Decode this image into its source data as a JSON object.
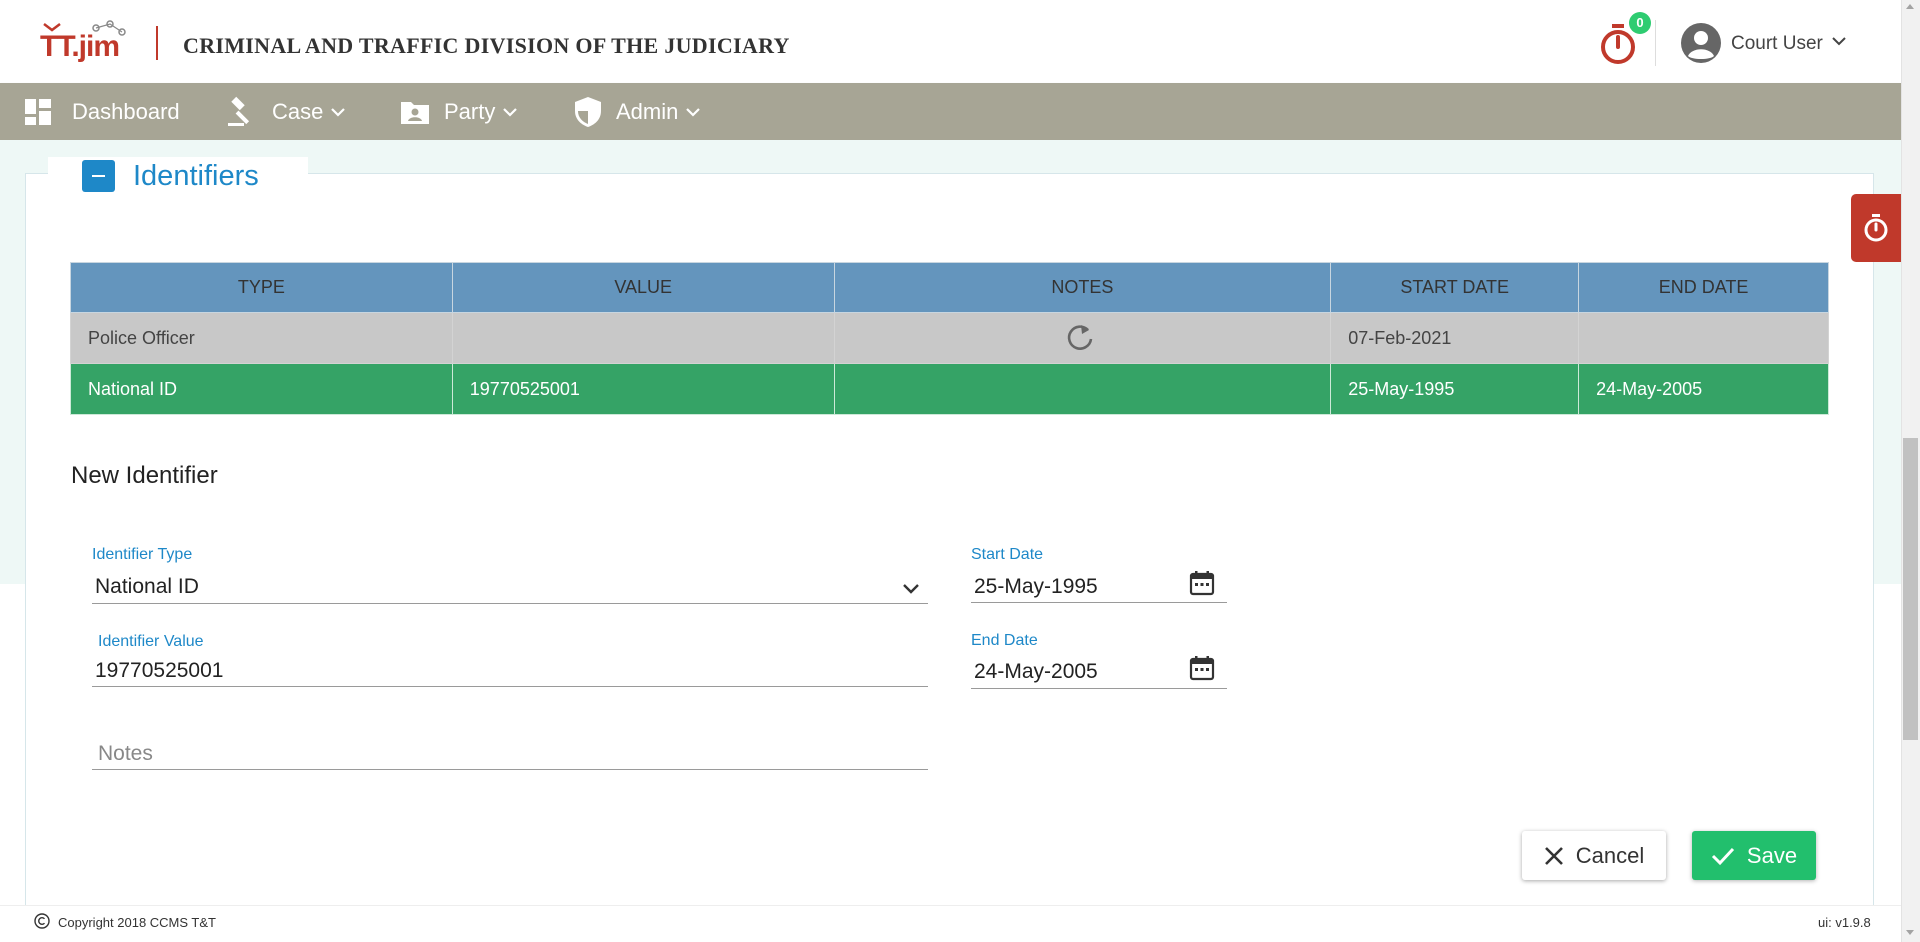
{
  "header": {
    "logo_text": "TT.jim",
    "app_title": "CRIMINAL AND TRAFFIC DIVISION OF THE JUDICIARY",
    "timer_badge": "0",
    "user_name": "Court User",
    "icons": {
      "timer": "stopwatch-icon",
      "avatar": "user-circle-icon",
      "menu": "chevron-down-icon"
    }
  },
  "nav": {
    "items": [
      {
        "label": "Dashboard",
        "icon": "dashboard-grid-icon",
        "has_menu": false
      },
      {
        "label": "Case",
        "icon": "gavel-icon",
        "has_menu": true
      },
      {
        "label": "Party",
        "icon": "contact-folder-icon",
        "has_menu": true
      },
      {
        "label": "Admin",
        "icon": "shield-icon",
        "has_menu": true
      }
    ]
  },
  "section": {
    "title": "Identifiers",
    "toggle_icon": "minus-icon"
  },
  "table": {
    "columns": [
      "TYPE",
      "VALUE",
      "NOTES",
      "START DATE",
      "END DATE"
    ],
    "rows": [
      {
        "type": "Police Officer",
        "value": "",
        "notes_icon": "refresh-icon",
        "start_date": "07-Feb-2021",
        "end_date": ""
      },
      {
        "type": "National ID",
        "value": "19770525001",
        "notes": "",
        "start_date": "25-May-1995",
        "end_date": "24-May-2005"
      }
    ]
  },
  "form": {
    "title": "New Identifier",
    "identifier_type": {
      "label": "Identifier Type",
      "value": "National ID"
    },
    "identifier_value": {
      "label": "Identifier Value",
      "value": "19770525001"
    },
    "notes": {
      "placeholder": "Notes"
    },
    "start_date": {
      "label": "Start Date",
      "value": "25-May-1995"
    },
    "end_date": {
      "label": "End Date",
      "value": "24-May-2005"
    }
  },
  "actions": {
    "cancel_label": "Cancel",
    "save_label": "Save"
  },
  "footer": {
    "copyright": "Copyright 2018  CCMS T&T",
    "version": "ui: v1.9.8"
  },
  "colors": {
    "brand_red": "#c0392b",
    "nav_bg": "#a7a595",
    "accent_blue": "#1e88c8",
    "table_header": "#6495bd",
    "row_selected": "#35a366",
    "row_gray": "#c8c8c8",
    "save_green": "#22bf6d"
  }
}
